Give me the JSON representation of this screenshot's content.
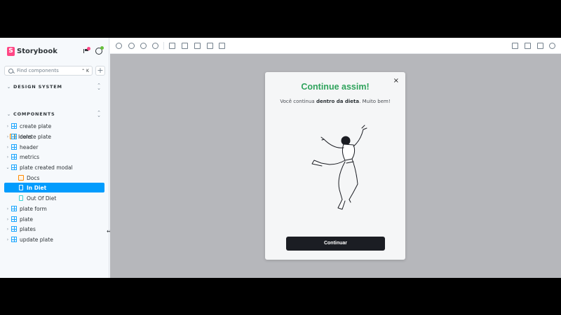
{
  "app": {
    "name": "Storybook"
  },
  "sidebar": {
    "search_placeholder": "Find components",
    "search_shortcut": "⌃ K",
    "add_label": "+",
    "sections": [
      {
        "title": "DESIGN SYSTEM",
        "items": [
          {
            "label": "Icons",
            "type": "doc"
          }
        ]
      },
      {
        "title": "COMPONENTS",
        "items": [
          {
            "label": "create plate"
          },
          {
            "label": "delete plate"
          },
          {
            "label": "header"
          },
          {
            "label": "metrics"
          },
          {
            "label": "plate created modal",
            "expanded": true
          },
          {
            "label": "Docs"
          },
          {
            "label": "In Diet",
            "selected": true
          },
          {
            "label": "Out Of Diet"
          },
          {
            "label": "plate form"
          },
          {
            "label": "plate"
          },
          {
            "label": "plates"
          },
          {
            "label": "update plate"
          }
        ]
      }
    ]
  },
  "modal": {
    "title": "Continue assim!",
    "text_before": "Você continua ",
    "text_bold": "dentro da dieta",
    "text_after": ". Muito bem!",
    "button_label": "Continuar",
    "close_glyph": "×"
  },
  "colors": {
    "accent": "#029cfd",
    "title_green": "#2fa35c",
    "button": "#1b1d23",
    "canvas_bg": "#b6b7bb"
  }
}
